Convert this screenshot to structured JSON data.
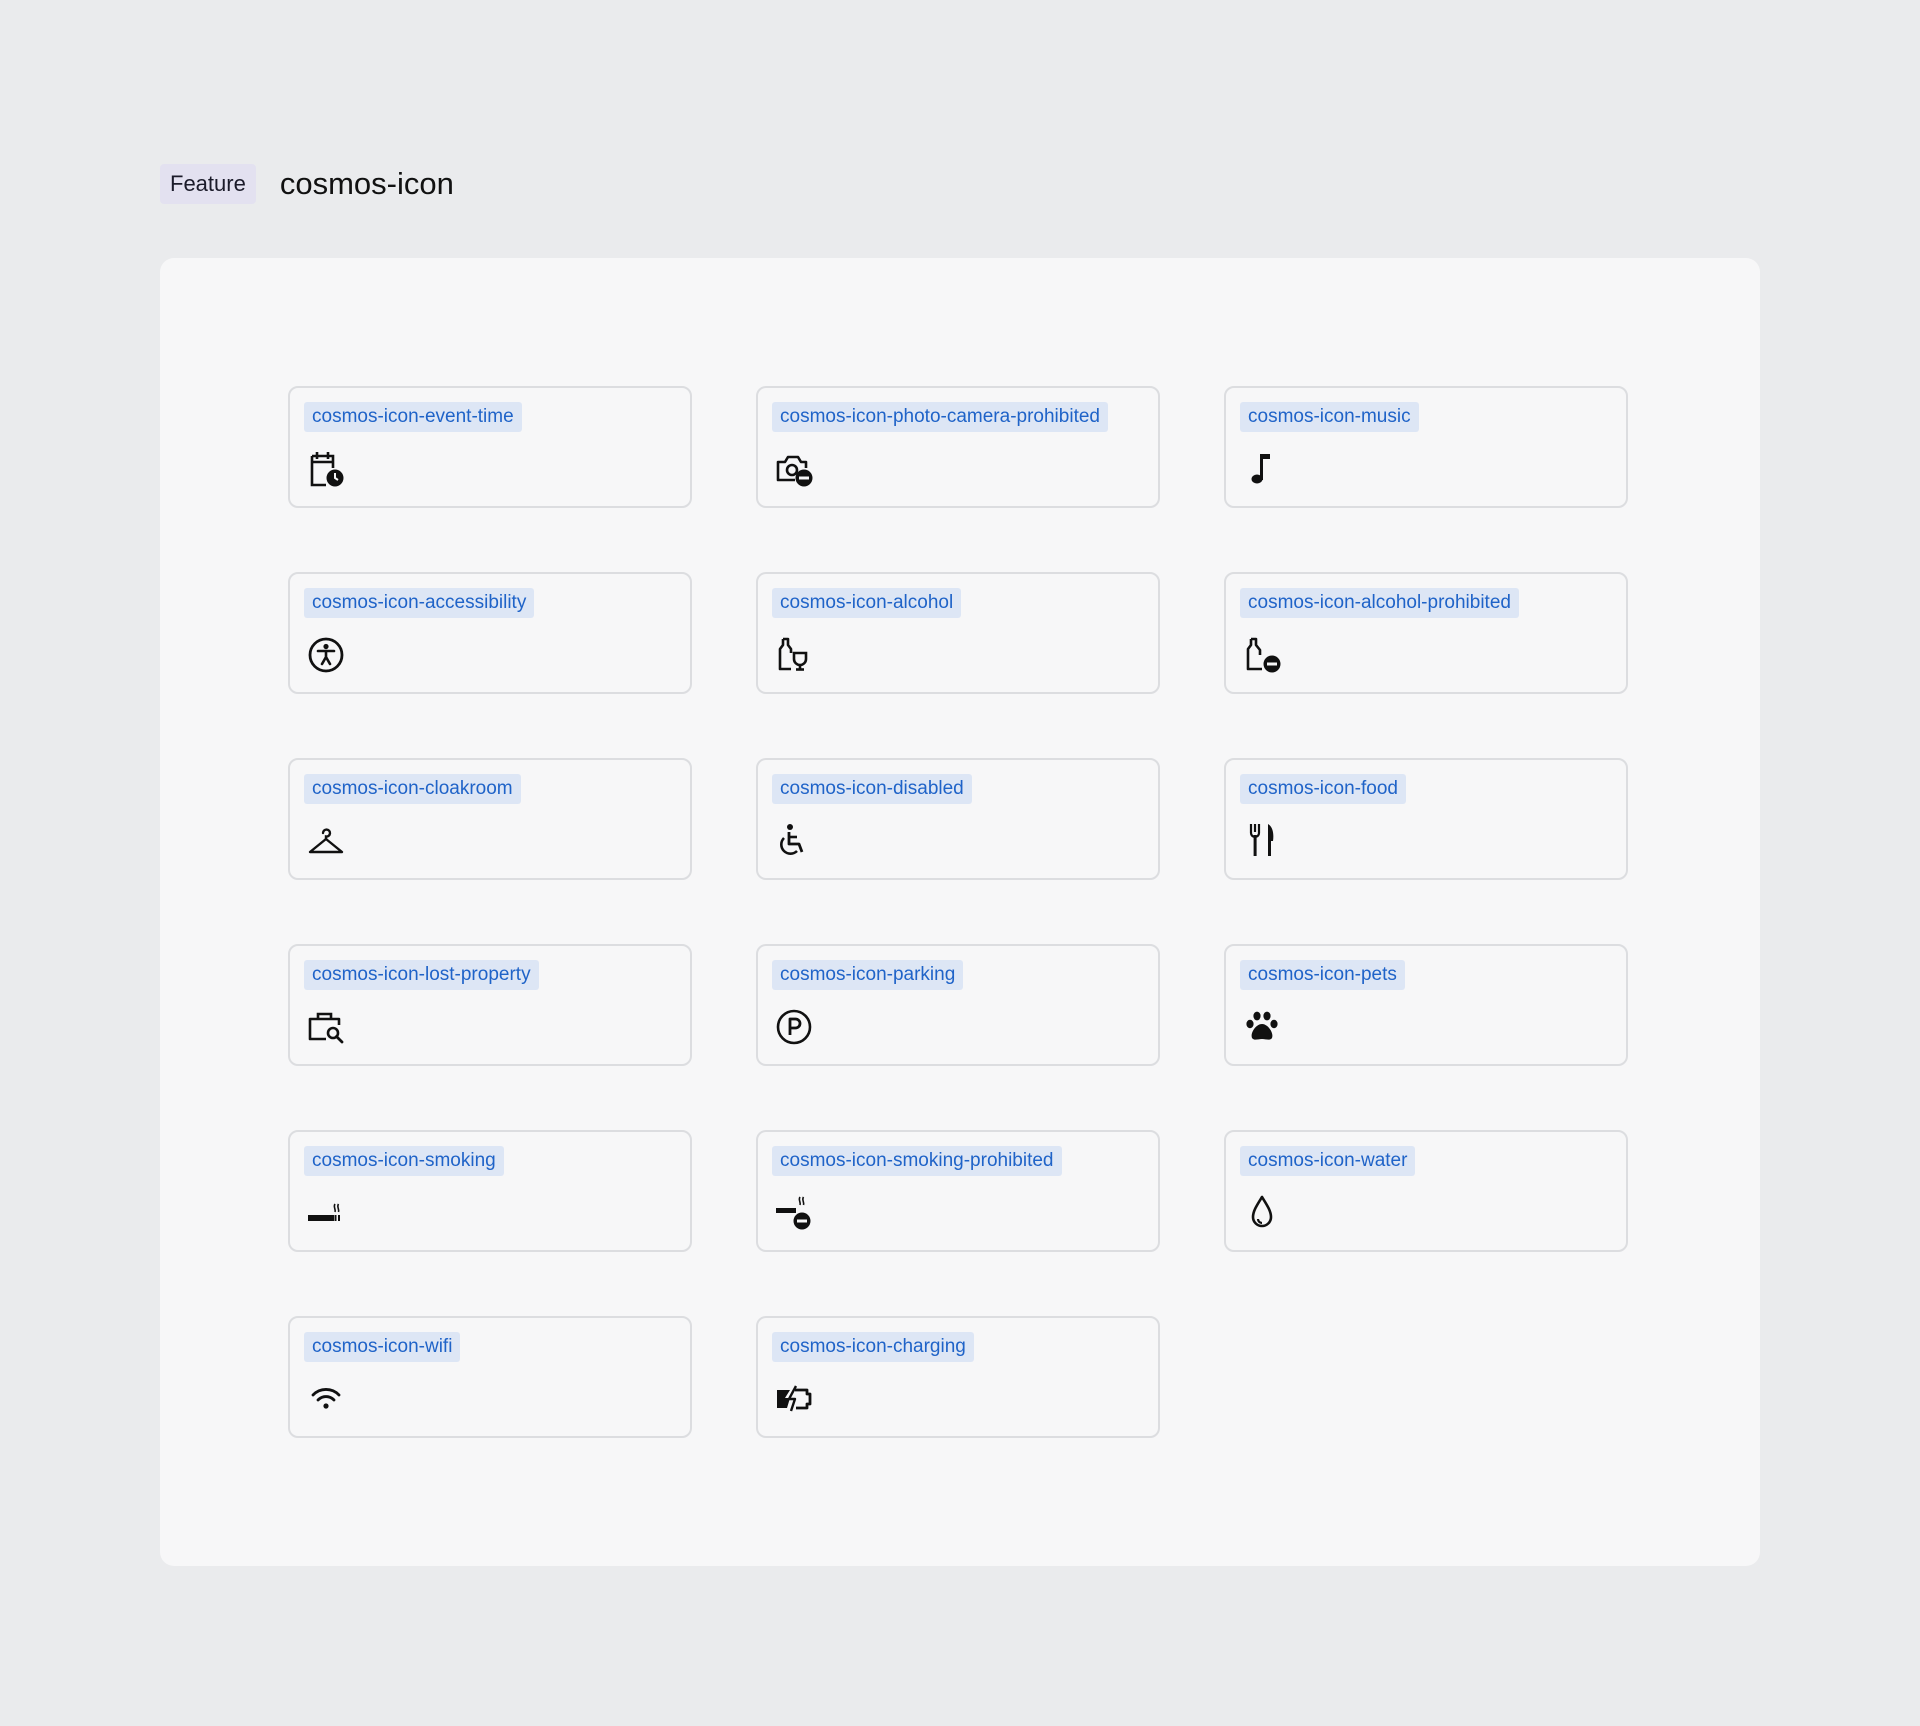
{
  "header": {
    "badge": "Feature",
    "title": "cosmos-icon"
  },
  "icons": [
    {
      "label": "cosmos-icon-event-time",
      "icon": "event-time-icon"
    },
    {
      "label": "cosmos-icon-photo-camera-prohibited",
      "icon": "photo-camera-prohibited-icon"
    },
    {
      "label": "cosmos-icon-music",
      "icon": "music-icon"
    },
    {
      "label": "cosmos-icon-accessibility",
      "icon": "accessibility-icon"
    },
    {
      "label": "cosmos-icon-alcohol",
      "icon": "alcohol-icon"
    },
    {
      "label": "cosmos-icon-alcohol-prohibited",
      "icon": "alcohol-prohibited-icon"
    },
    {
      "label": "cosmos-icon-cloakroom",
      "icon": "cloakroom-icon"
    },
    {
      "label": "cosmos-icon-disabled",
      "icon": "disabled-icon"
    },
    {
      "label": "cosmos-icon-food",
      "icon": "food-icon"
    },
    {
      "label": "cosmos-icon-lost-property",
      "icon": "lost-property-icon"
    },
    {
      "label": "cosmos-icon-parking",
      "icon": "parking-icon"
    },
    {
      "label": "cosmos-icon-pets",
      "icon": "pets-icon"
    },
    {
      "label": "cosmos-icon-smoking",
      "icon": "smoking-icon"
    },
    {
      "label": "cosmos-icon-smoking-prohibited",
      "icon": "smoking-prohibited-icon"
    },
    {
      "label": "cosmos-icon-water",
      "icon": "water-icon"
    },
    {
      "label": "cosmos-icon-wifi",
      "icon": "wifi-icon"
    },
    {
      "label": "cosmos-icon-charging",
      "icon": "charging-icon"
    }
  ],
  "colors": {
    "page_background": "#eaebed",
    "panel_background": "#f7f7f8",
    "label_background": "#dde6f5",
    "label_text": "#1f63c8",
    "icon": "#111111"
  }
}
